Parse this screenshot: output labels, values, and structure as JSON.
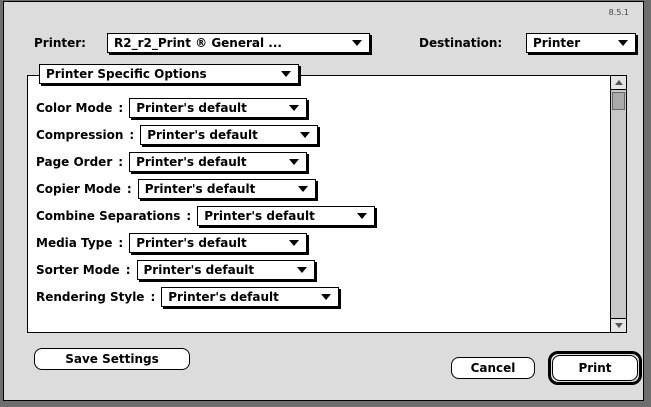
{
  "version": "8.5.1",
  "printer": {
    "label": "Printer:",
    "value": "R2_r2_Print ® General ..."
  },
  "destination": {
    "label": "Destination:",
    "value": "Printer"
  },
  "section_popup": "Printer Specific Options",
  "options": [
    {
      "label": "Color Mode",
      "value": "Printer's default"
    },
    {
      "label": "Compression",
      "value": "Printer's default"
    },
    {
      "label": "Page Order",
      "value": "Printer's default"
    },
    {
      "label": "Copier Mode",
      "value": "Printer's default"
    },
    {
      "label": "Combine Separations",
      "value": "Printer's default"
    },
    {
      "label": "Media Type",
      "value": "Printer's default"
    },
    {
      "label": "Sorter Mode",
      "value": "Printer's default"
    },
    {
      "label": "Rendering Style",
      "value": "Printer's default"
    }
  ],
  "option_separator": ":",
  "buttons": {
    "save": "Save Settings",
    "cancel": "Cancel",
    "print": "Print"
  }
}
